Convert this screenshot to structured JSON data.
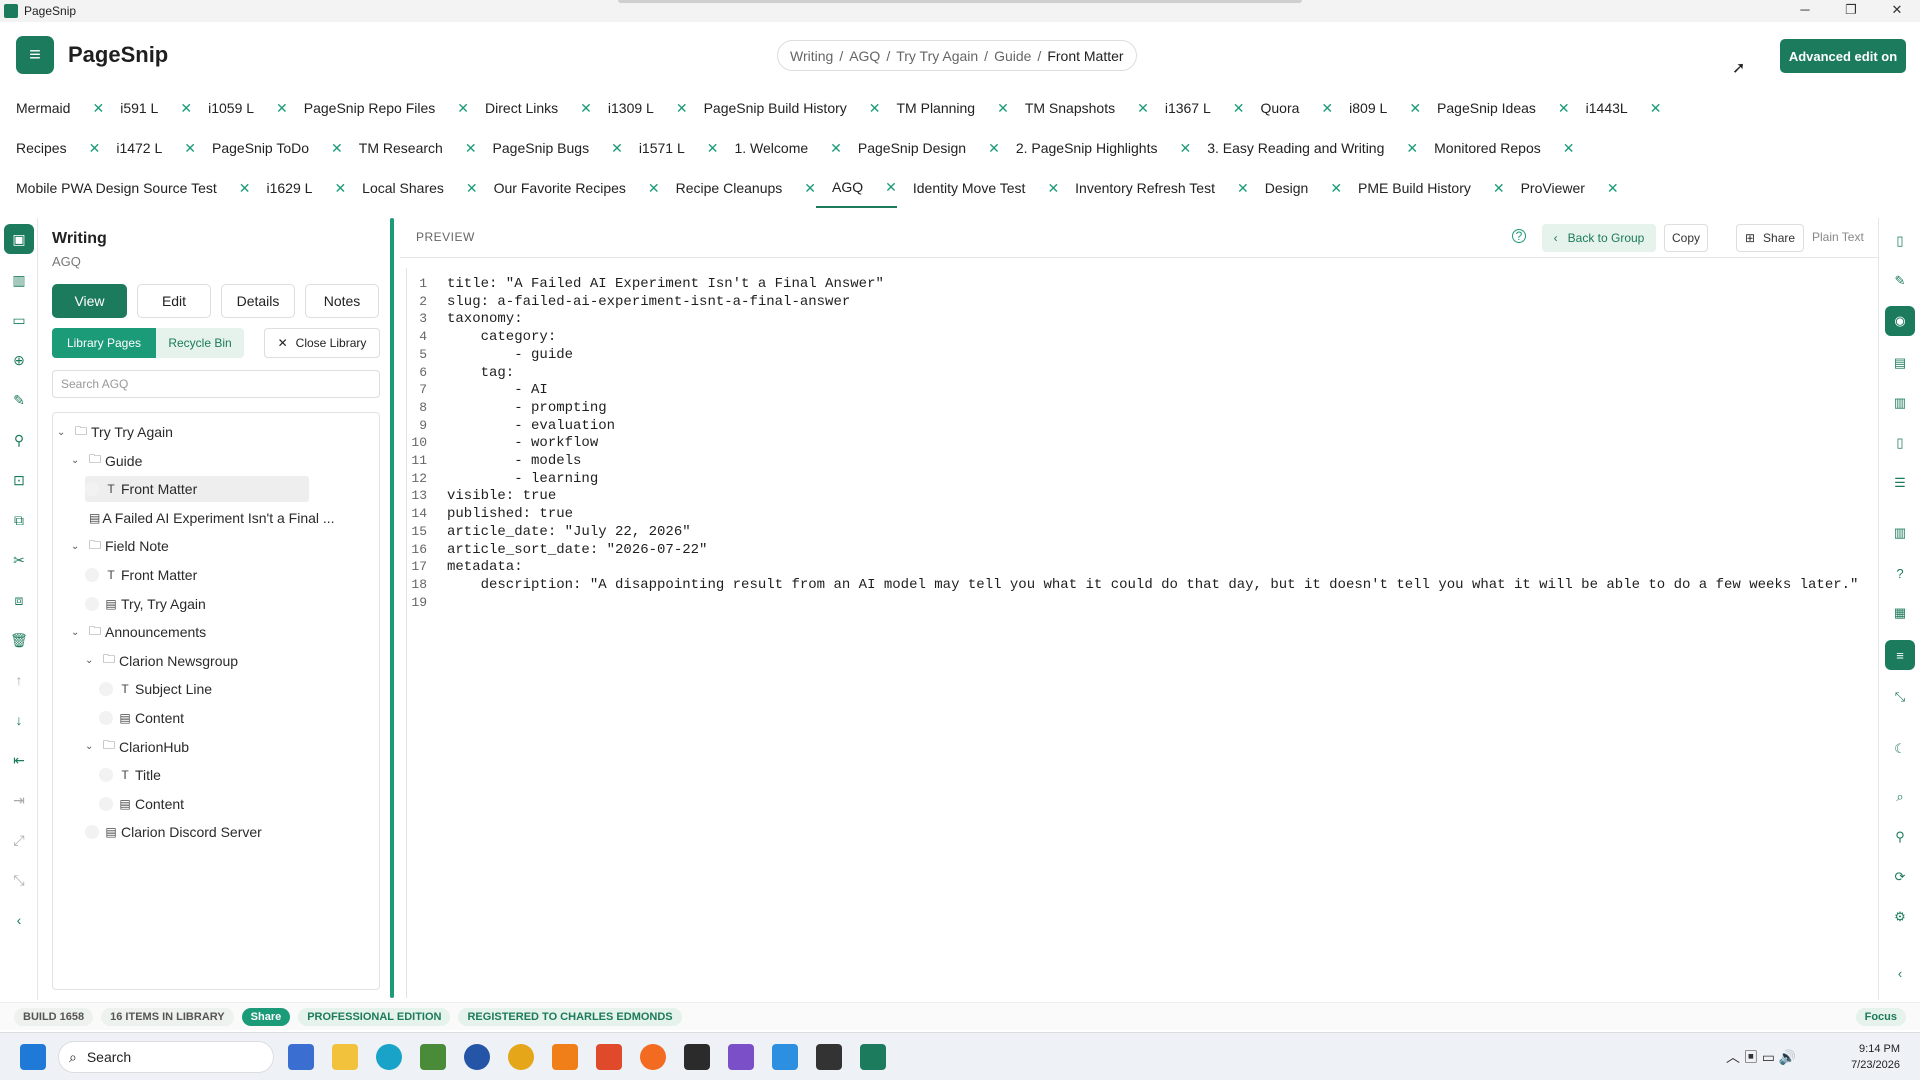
{
  "window": {
    "title": "PageSnip",
    "controls": [
      "─",
      "❐",
      "✕"
    ]
  },
  "brand": {
    "name": "PageSnip",
    "logo_glyph": "≡"
  },
  "breadcrumb": [
    "Writing",
    "AGQ",
    "Try Try Again",
    "Guide"
  ],
  "breadcrumb_current": "Front Matter",
  "advanced_button": "Advanced edit on",
  "tab_rows": [
    [
      "Mermaid",
      "i591 L",
      "i1059 L",
      "PageSnip Repo Files",
      "Direct Links",
      "i1309 L",
      "PageSnip Build History",
      "TM Planning",
      "TM Snapshots",
      "i1367 L",
      "Quora",
      "i809 L",
      "PageSnip Ideas",
      "i1443L"
    ],
    [
      "Recipes",
      "i1472 L",
      "PageSnip ToDo",
      "TM Research",
      "PageSnip Bugs",
      "i1571 L",
      "1. Welcome",
      "PageSnip Design",
      "2. PageSnip Highlights",
      "3. Easy Reading and Writing",
      "Monitored Repos"
    ],
    [
      "Mobile PWA Design Source Test",
      "i1629 L",
      "Local Shares",
      "Our Favorite Recipes",
      "Recipe Cleanups",
      "AGQ",
      "Identity Move Test",
      "Inventory Refresh Test",
      "Design",
      "PME Build History",
      "ProViewer"
    ]
  ],
  "active_tab": "AGQ",
  "sidebar": {
    "title": "Writing",
    "subtitle": "AGQ",
    "modes": [
      "View",
      "Edit",
      "Details",
      "Notes"
    ],
    "library_pages": "Library Pages",
    "recycle_bin": "Recycle Bin",
    "close_library": "Close Library",
    "search_placeholder": "Search AGQ",
    "tree": [
      {
        "label": "Try Try Again",
        "level": 0,
        "kind": "folder",
        "expanded": true
      },
      {
        "label": "Guide",
        "level": 1,
        "kind": "folder",
        "expanded": true
      },
      {
        "label": "Front Matter",
        "level": 2,
        "kind": "text",
        "selected": true
      },
      {
        "label": "A Failed AI Experiment Isn't a Final ...",
        "level": 2,
        "kind": "doc"
      },
      {
        "label": "Field Note",
        "level": 1,
        "kind": "folder",
        "expanded": true
      },
      {
        "label": "Front Matter",
        "level": 2,
        "kind": "text"
      },
      {
        "label": "Try, Try Again",
        "level": 2,
        "kind": "doc"
      },
      {
        "label": "Announcements",
        "level": 1,
        "kind": "folder",
        "expanded": true
      },
      {
        "label": "Clarion Newsgroup",
        "level": 2,
        "kind": "folder",
        "expanded": true
      },
      {
        "label": "Subject Line",
        "level": 3,
        "kind": "text"
      },
      {
        "label": "Content",
        "level": 3,
        "kind": "doc"
      },
      {
        "label": "ClarionHub",
        "level": 2,
        "kind": "folder",
        "expanded": true
      },
      {
        "label": "Title",
        "level": 3,
        "kind": "text"
      },
      {
        "label": "Content",
        "level": 3,
        "kind": "doc"
      },
      {
        "label": "Clarion Discord Server",
        "level": 2,
        "kind": "doc"
      }
    ]
  },
  "preview": {
    "label": "PREVIEW",
    "help": "?",
    "back": "Back to Group",
    "copy": "Copy",
    "share": "Share",
    "plain": "Plain Text",
    "lines": [
      "title: \"A Failed AI Experiment Isn't a Final Answer\"",
      "slug: a-failed-ai-experiment-isnt-a-final-answer",
      "taxonomy:",
      "    category:",
      "        - guide",
      "    tag:",
      "        - AI",
      "        - prompting",
      "        - evaluation",
      "        - workflow",
      "        - models",
      "        - learning",
      "visible: true",
      "published: true",
      "article_date: \"July 22, 2026\"",
      "article_sort_date: \"2026-07-22\"",
      "metadata:",
      "    description: \"A disappointing result from an AI model may tell you what it could do that day, but it doesn't tell you what it will be able to do a few weeks later.\"",
      ""
    ]
  },
  "status": {
    "build": "BUILD 1658",
    "items": "16 ITEMS IN LIBRARY",
    "share": "Share",
    "edition": "PROFESSIONAL EDITION",
    "registered": "REGISTERED TO CHARLES EDMONDS",
    "focus": "Focus"
  },
  "taskbar": {
    "search": "Search",
    "time": "9:14 PM",
    "date": "7/23/2026"
  },
  "colors": {
    "accent": "#1b7b5c",
    "accent_light": "#1b9b78"
  }
}
